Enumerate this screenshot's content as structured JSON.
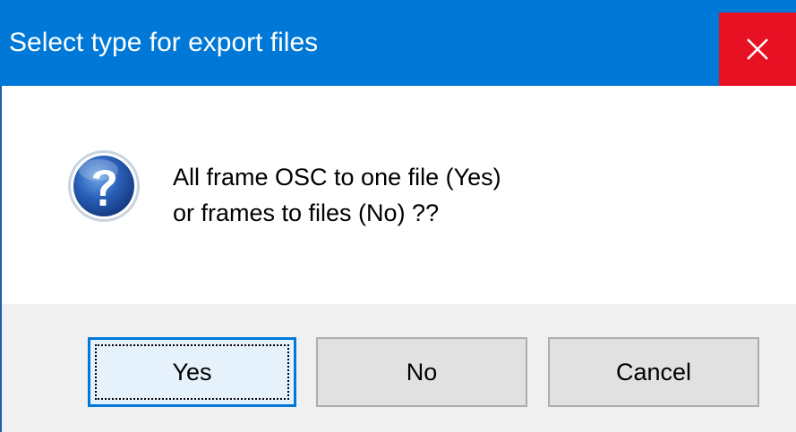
{
  "window": {
    "title": "Select type for export files",
    "close_icon": "close-icon"
  },
  "dialog": {
    "icon": "question-icon",
    "message_line1": "All frame OSC to one file (Yes)",
    "message_line2": "or frames to files (No) ??"
  },
  "buttons": {
    "yes_label": "Yes",
    "no_label": "No",
    "cancel_label": "Cancel"
  },
  "colors": {
    "titlebar": "#0078d7",
    "close_button": "#e81123",
    "footer": "#f0f0f0",
    "default_button_border": "#0078d7"
  }
}
